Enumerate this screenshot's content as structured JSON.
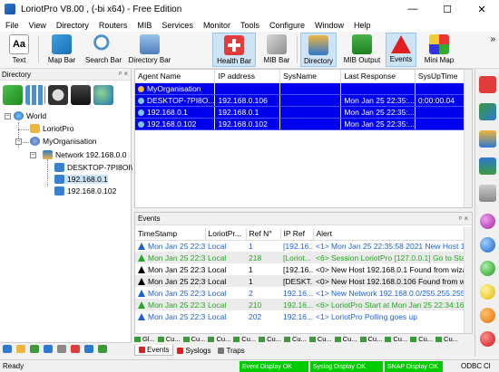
{
  "window": {
    "title": "LoriotPro V8.00 , (-bi x64) - Free Edition",
    "minimize": "—",
    "maximize": "☐",
    "close": "✕"
  },
  "menu": [
    "File",
    "View",
    "Directory",
    "Routers",
    "MIB",
    "Services",
    "Monitor",
    "Tools",
    "Configure",
    "Window",
    "Help"
  ],
  "toolbar": [
    "Text",
    "Map Bar",
    "Search Bar",
    "Directory Bar",
    "Health Bar",
    "MIB Bar",
    "Directory",
    "MIB Output",
    "Events",
    "Mini Map"
  ],
  "toolbar_more": "»",
  "directory": {
    "title": "Directory",
    "pin": "ᵖ ×",
    "tree": {
      "world": "World",
      "loriotpro": "LoriotPro",
      "myorg": "MyOrganisation",
      "network": "Network 192.168.0.0",
      "host1": "DESKTOP-7PI8OI\\",
      "host2": "192.168.0.1",
      "host3": "192.168.0.102"
    }
  },
  "agents": {
    "columns": [
      "Agent Name",
      "IP address",
      "SysName",
      "Last Response",
      "SysUpTime"
    ],
    "rows": [
      [
        "MyOrganisation",
        "",
        "",
        "",
        ""
      ],
      [
        "DESKTOP-7PI8O...",
        "192.168.0.106",
        "",
        "Mon Jan 25 22:35:...",
        "0:00:00.04"
      ],
      [
        "192.168.0.1",
        "192.168.0.1",
        "",
        "Mon Jan 25 22:35:...",
        ""
      ],
      [
        "192.168.0.102",
        "192.168.0.102",
        "",
        "Mon Jan 25 22:35:...",
        ""
      ]
    ]
  },
  "events": {
    "title": "Events",
    "pin": "ᵖ ×",
    "columns": [
      "TimeStamp",
      "LoriotPr...",
      "Ref N°",
      "IP Ref",
      "Alert"
    ],
    "rows": [
      {
        "ts": "Mon Jan 25 22:3...",
        "src": "Local",
        "ref": "1",
        "ip": "[192.16...",
        "alert": "<1> Mon Jan 25 22:35:58 2021 New Host 19",
        "color": "#1a5fd6",
        "sev": "#1a5fd6"
      },
      {
        "ts": "Mon Jan 25 22:3...",
        "src": "Local",
        "ref": "218",
        "ip": "[Loriot...",
        "alert": "<6> Session LoriotPro [127.0.0.1] Go to Stat",
        "color": "#22a822",
        "sev": "#22a822"
      },
      {
        "ts": "Mon Jan 25 22:3...",
        "src": "Local",
        "ref": "1",
        "ip": "[192.16...",
        "alert": "<0> New Host 192.168.0.1 Found from wizar",
        "color": "#000000",
        "sev": "#000000"
      },
      {
        "ts": "Mon Jan 25 22:3...",
        "src": "Local",
        "ref": "1",
        "ip": "[DESKT...",
        "alert": "<0> New Host 192.168.0.106 Found from wi",
        "color": "#000000",
        "sev": "#000000"
      },
      {
        "ts": "Mon Jan 25 22:3...",
        "src": "Local",
        "ref": "2",
        "ip": "192.16...",
        "alert": "<1> New Network  192.168.0.0/255.255.255.",
        "color": "#1a5fd6",
        "sev": "#1a5fd6"
      },
      {
        "ts": "Mon Jan 25 22:3...",
        "src": "Local",
        "ref": "210",
        "ip": "192.16...",
        "alert": "<6> LoriotPro Start at Mon Jan 25 22:34:16",
        "color": "#22a822",
        "sev": "#22a822"
      },
      {
        "ts": "Mon Jan 25 22:3...",
        "src": "Local",
        "ref": "202",
        "ip": "192.16...",
        "alert": "<1> LoriotPro Polling goes up",
        "color": "#1a5fd6",
        "sev": "#1a5fd6"
      }
    ],
    "subtabs": [
      "Gl...",
      "Cu...",
      "Cu...",
      "Cu...",
      "Cu...",
      "Cu...",
      "Cu...",
      "Cu...",
      "Cu...",
      "Cu...",
      "Cu...",
      "Cu...",
      "Cu..."
    ],
    "tabs": [
      "Events",
      "Syslogs",
      "Traps"
    ]
  },
  "status": {
    "ready": "Ready",
    "event_display": "Event Display OK",
    "syslog_display": "Syslog Display OK",
    "snmp_display": "SNAP Display OK",
    "odbc": "ODBC",
    "ci": "Cl"
  },
  "colors": {
    "selection": "#0000ee",
    "ok_green": "#00cc00"
  }
}
